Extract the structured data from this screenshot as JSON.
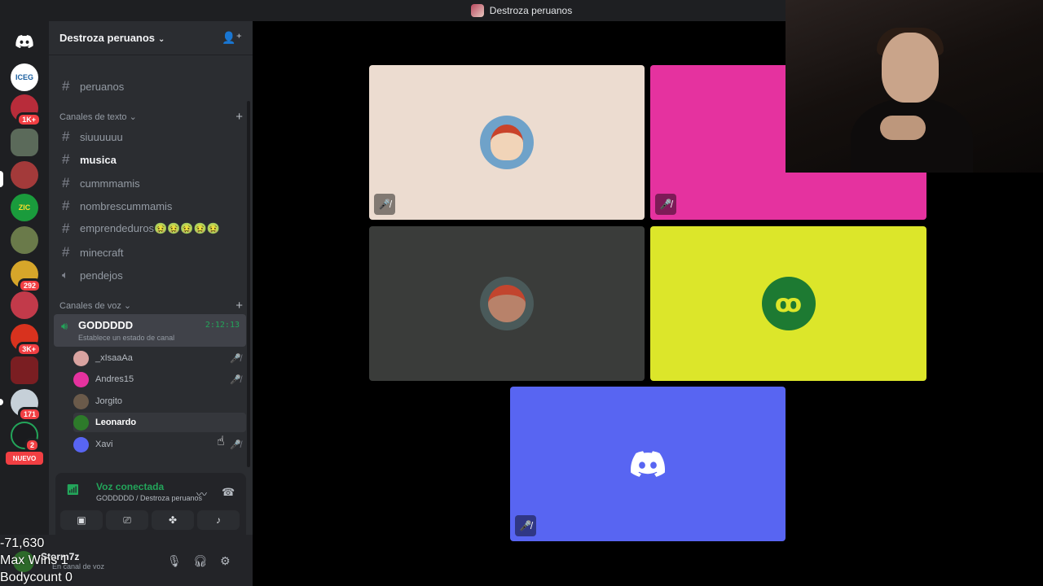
{
  "titlebar": {
    "title": "Destroza peruanos"
  },
  "rail": {
    "servers": [
      {
        "name": "ICEG",
        "badge": ""
      },
      {
        "name": "",
        "badge": "1K+"
      },
      {
        "name": "",
        "badge": ""
      },
      {
        "name": "",
        "badge": ""
      },
      {
        "name": "ZIC",
        "badge": ""
      },
      {
        "name": "",
        "badge": ""
      },
      {
        "name": "",
        "badge": "292"
      },
      {
        "name": "",
        "badge": ""
      },
      {
        "name": "",
        "badge": "3K+"
      },
      {
        "name": "",
        "badge": ""
      },
      {
        "name": "",
        "badge": "171"
      },
      {
        "name": "",
        "badge": "2"
      }
    ],
    "new_label": "NUEVO"
  },
  "sidebar": {
    "server_name": "Destroza peruanos",
    "top_channel": "peruanos",
    "text_category": "Canales de texto",
    "text_channels": [
      "siuuuuuu",
      "musica",
      "cummmamis",
      "nombrescummamis",
      "emprendeduros🤢🤢🤢🤢🤢",
      "minecraft"
    ],
    "voice_category": "Canales de voz",
    "voice_channels": [
      "pendejos"
    ],
    "active_voice": {
      "name": "GODDDDD",
      "status": "Establece un estado de canal",
      "timer": "2:12:13",
      "users": [
        "_xIsaaAa",
        "Andres15",
        "Jorgito",
        "Leonardo",
        "Xavi"
      ]
    }
  },
  "voice_panel": {
    "status": "Voz conectada",
    "location": "GODDDDD / Destroza peruanos"
  },
  "user_panel": {
    "username": "Storm7z",
    "status": "En canal de voz"
  },
  "overlay": {
    "line1": "-71,630",
    "line2": "Max Wins 1",
    "line3": "Bodycount 0"
  },
  "colors": {
    "tile1": "#ecdcd0",
    "tile2": "#e5329f",
    "tile3": "#3a3c3a",
    "tile4": "#dce62a",
    "tile5": "#5865f2",
    "green": "#23a55a"
  }
}
